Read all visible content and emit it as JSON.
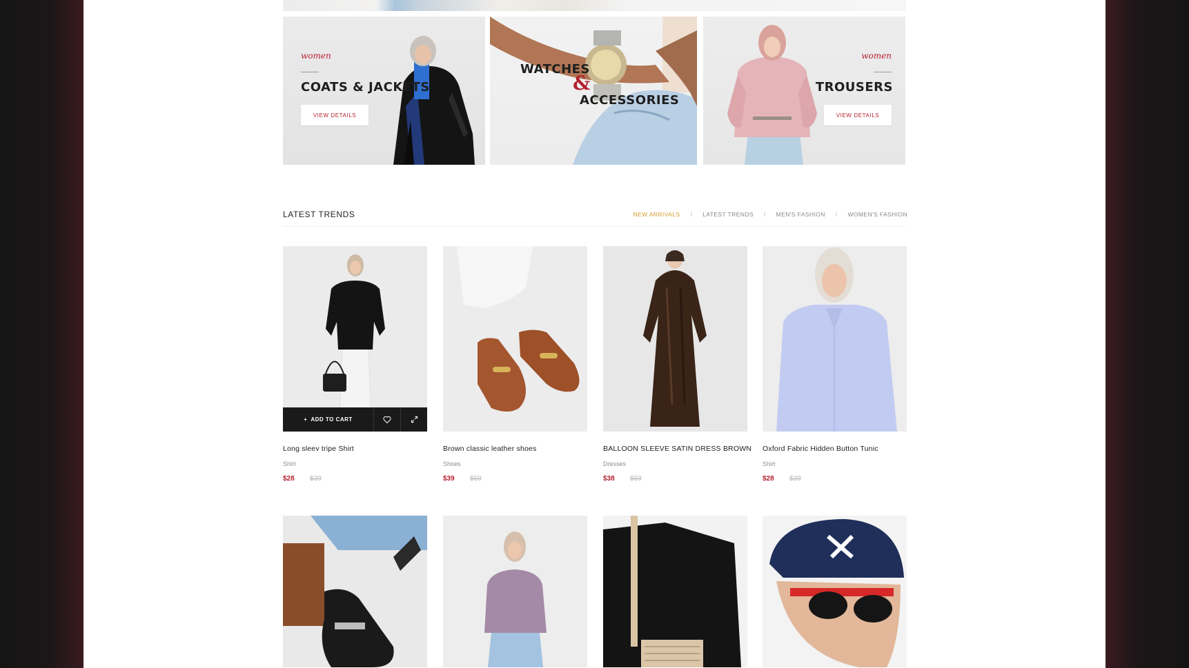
{
  "banners": [
    {
      "tagline": "women",
      "title": "COATS & JACKETS",
      "button": "VIEW DETAILS"
    },
    {
      "title_line1": "WATCHES",
      "ampersand": "&",
      "title_line2": "ACCESSORIES"
    },
    {
      "tagline": "women",
      "title": "TROUSERS",
      "button": "VIEW DETAILS"
    }
  ],
  "section": {
    "title": "LATEST TRENDS",
    "filters": [
      "NEW ARRIVALS",
      "LATEST TRENDS",
      "MEN'S FASHION",
      "WOMEN'S FASHION"
    ],
    "separator": "/"
  },
  "products": [
    {
      "name": "Long sleev tripe Shirt",
      "category": "Shirt",
      "price": "$28",
      "old_price": "$39"
    },
    {
      "name": "Brown classic leather shoes",
      "category": "Shoes",
      "price": "$39",
      "old_price": "$69"
    },
    {
      "name": "BALLOON SLEEVE SATIN DRESS BROWN",
      "category": "Dresses",
      "price": "$38",
      "old_price": "$69"
    },
    {
      "name": "Oxford Fabric Hidden Button Tunic",
      "category": "Shirt",
      "price": "$28",
      "old_price": "$39"
    }
  ],
  "cart": {
    "add_label": "ADD TO CART",
    "plus": "+"
  },
  "colors": {
    "accent": "#b51f2e",
    "active_filter": "#d89a2b",
    "dark": "#1a1a1a"
  }
}
